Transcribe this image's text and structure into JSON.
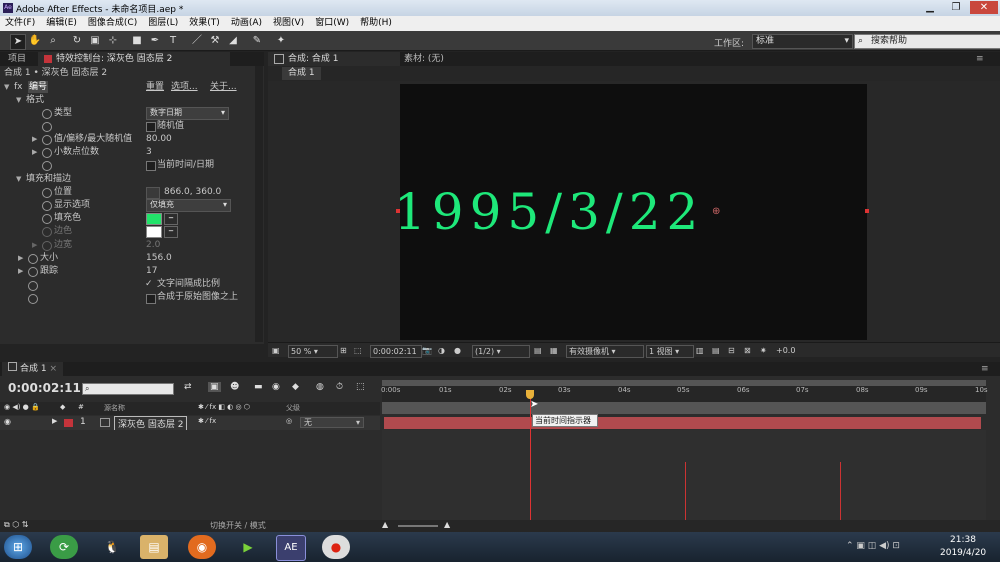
{
  "window": {
    "title": "Adobe After Effects - 未命名项目.aep *",
    "app_icon": "Ae"
  },
  "menu": [
    "文件(F)",
    "编辑(E)",
    "图像合成(C)",
    "图层(L)",
    "效果(T)",
    "动画(A)",
    "视图(V)",
    "窗口(W)",
    "帮助(H)"
  ],
  "toolbar": {
    "workspace_label": "工作区:",
    "workspace_value": "标准",
    "search_placeholder": "搜索帮助"
  },
  "project_tab": "项目",
  "effects_panel": {
    "tab_title": "特效控制台: 深灰色 固态层 2",
    "breadcrumb": "合成 1 • 深灰色 固态层 2",
    "effect_name": "编号",
    "reset": "重置",
    "options": "选项...",
    "about": "关于...",
    "format": "格式",
    "type_label": "类型",
    "type_value": "数字日期",
    "random_label": "随机值",
    "minmax_label": "值/偏移/最大随机值",
    "minmax_value": "80.00",
    "decimals_label": "小数点位数",
    "decimals_value": "3",
    "current_time_label": "当前时间/日期",
    "fill_stroke": "填充和描边",
    "position_label": "位置",
    "position_value": "866.0, 360.0",
    "display_label": "显示选项",
    "display_value": "仅填充",
    "fill_color_label": "填充色",
    "stroke_color_label": "边色",
    "stroke_width_label": "边宽",
    "stroke_width_value": "2.0",
    "size_label": "大小",
    "size_value": "156.0",
    "tracking_label": "跟踪",
    "tracking_value": "17",
    "proportional_label": "文字间隔成比例",
    "composite_label": "合成于原始图像之上",
    "fill_color": "#22e36a",
    "stroke_color": "#ffffff"
  },
  "comp_panel": {
    "tab_title": "合成: 合成 1",
    "footage_tab": "素材: (无)",
    "sub_tab": "合成 1",
    "display_text": "1995/3/22",
    "text_color": "#1ee87a"
  },
  "viewer_bar": {
    "zoom": "50 %",
    "timecode": "0:00:02:11",
    "resolution": "(1/2)",
    "camera": "有效摄像机",
    "views": "1 视图",
    "exposure": "+0.0"
  },
  "timeline": {
    "tab": "合成 1",
    "timecode": "0:00:02:11",
    "ruler": [
      "0:00s",
      "01s",
      "02s",
      "03s",
      "04s",
      "05s",
      "06s",
      "07s",
      "08s",
      "09s",
      "10s"
    ],
    "source_name_header": "源名称",
    "parent_header": "父级",
    "layer_index": "1",
    "layer_name": "深灰色 固态层 2",
    "layer_parent": "无",
    "tooltip": "当前时间指示器",
    "toggle_label": "切换开关 / 模式",
    "layer_color": "#c4343b",
    "bar_color": "#b04a4e"
  },
  "taskbar": {
    "ae_label": "AE",
    "time": "21:38",
    "date": "2019/4/20"
  }
}
